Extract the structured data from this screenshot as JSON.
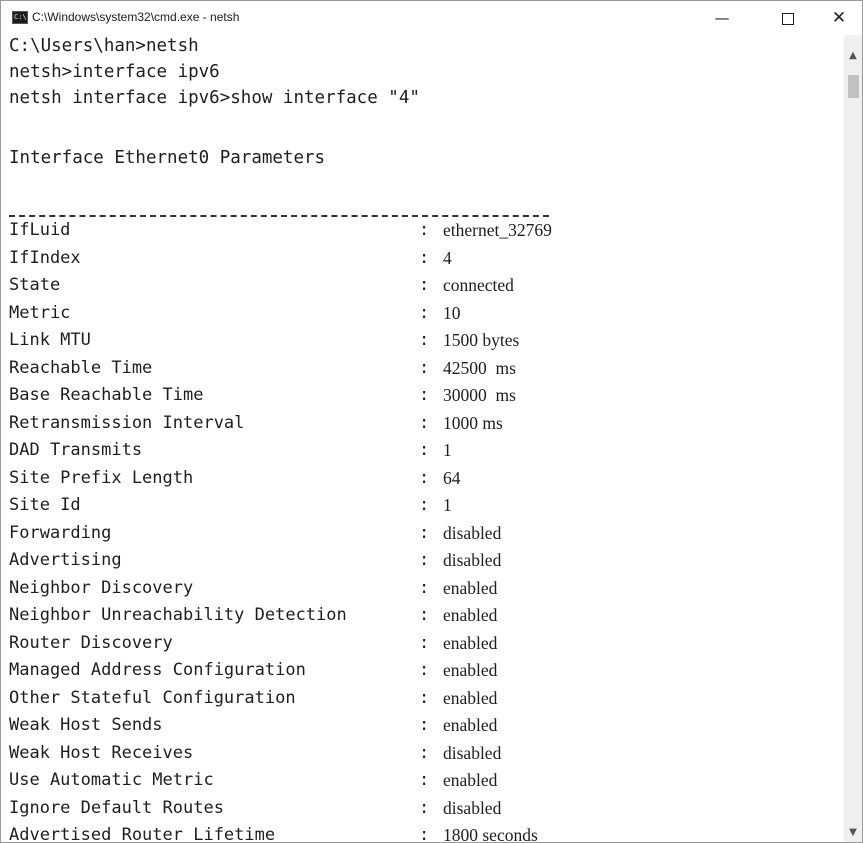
{
  "window": {
    "title": "C:\\Windows\\system32\\cmd.exe - netsh",
    "app_icon_text": "C:\\",
    "minimize_glyph": "—",
    "close_glyph": "✕"
  },
  "console": {
    "commands": [
      "C:\\Users\\han>netsh",
      "netsh>interface ipv6",
      "netsh interface ipv6>show interface \"4\""
    ],
    "heading": "Interface Ethernet0 Parameters",
    "separator": ":",
    "rows": [
      {
        "name": "IfLuid",
        "value": "ethernet_32769"
      },
      {
        "name": "IfIndex",
        "value": "4"
      },
      {
        "name": "State",
        "value": "connected"
      },
      {
        "name": "Metric",
        "value": "10"
      },
      {
        "name": "Link MTU",
        "value": "1500 bytes"
      },
      {
        "name": "Reachable Time",
        "value": "42500  ms"
      },
      {
        "name": "Base Reachable Time",
        "value": "30000  ms"
      },
      {
        "name": "Retransmission Interval",
        "value": "1000 ms"
      },
      {
        "name": "DAD Transmits",
        "value": "1"
      },
      {
        "name": "Site Prefix Length",
        "value": "64"
      },
      {
        "name": "Site Id",
        "value": "1"
      },
      {
        "name": "Forwarding",
        "value": "disabled"
      },
      {
        "name": "Advertising",
        "value": "disabled"
      },
      {
        "name": "Neighbor Discovery",
        "value": "enabled"
      },
      {
        "name": "Neighbor Unreachability Detection",
        "value": "enabled"
      },
      {
        "name": "Router Discovery",
        "value": "enabled"
      },
      {
        "name": "Managed Address Configuration",
        "value": "enabled"
      },
      {
        "name": "Other Stateful Configuration",
        "value": "enabled"
      },
      {
        "name": "Weak Host Sends",
        "value": "enabled"
      },
      {
        "name": "Weak Host Receives",
        "value": "disabled"
      },
      {
        "name": "Use Automatic Metric",
        "value": "enabled"
      },
      {
        "name": "Ignore Default Routes",
        "value": "disabled"
      },
      {
        "name": "Advertised Router Lifetime",
        "value": "1800 seconds"
      }
    ]
  },
  "scrollbar": {
    "up_glyph": "▲",
    "down_glyph": "▼"
  }
}
